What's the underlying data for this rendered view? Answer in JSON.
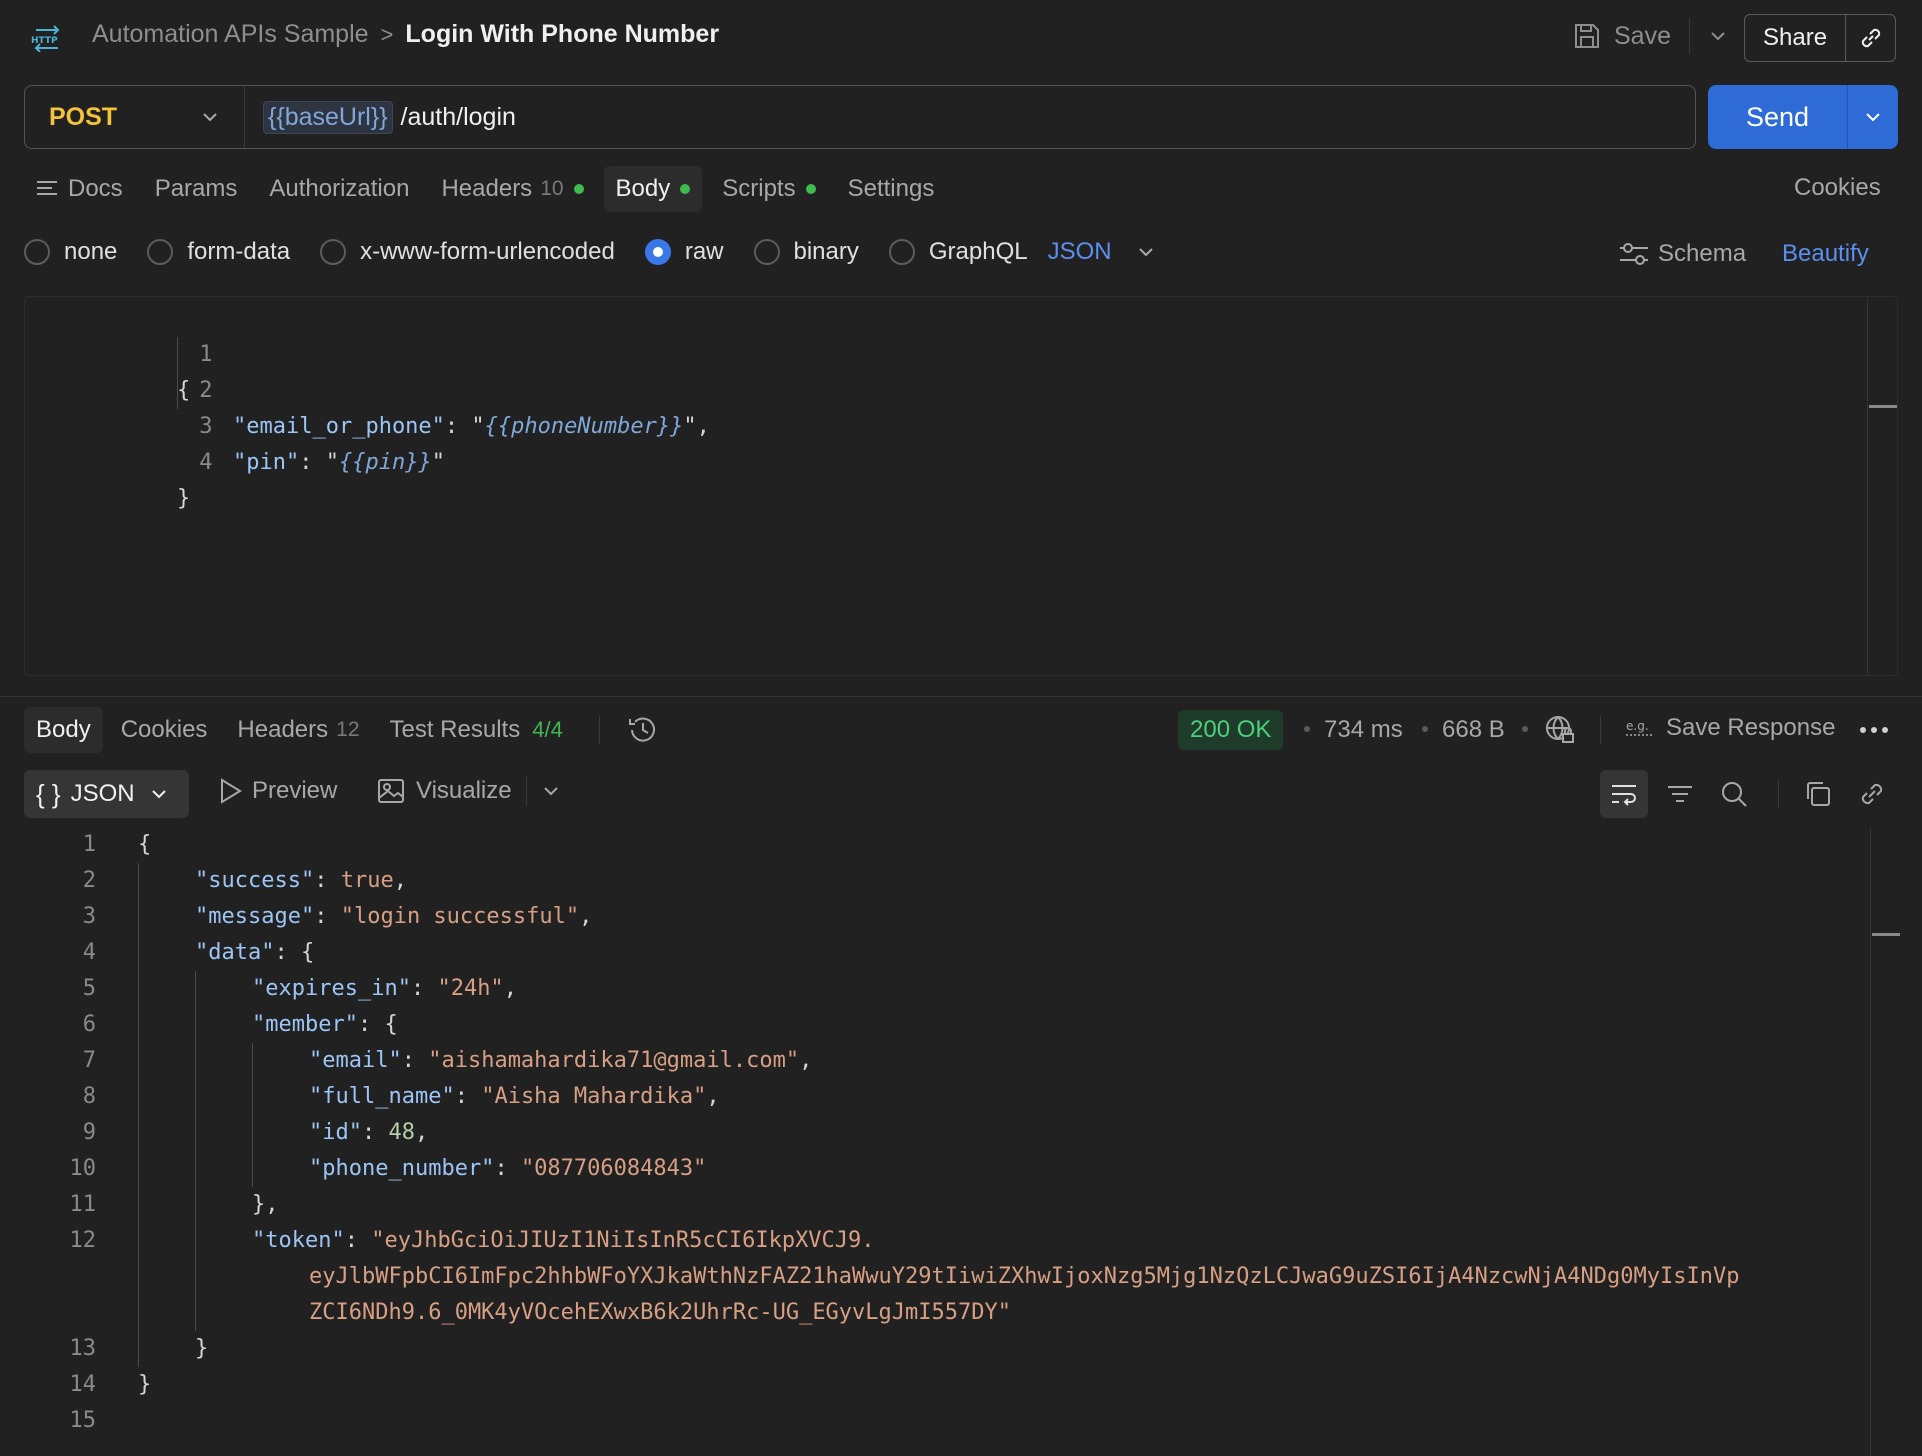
{
  "header": {
    "collection": "Automation APIs Sample",
    "separator": ">",
    "request_name": "Login With Phone Number",
    "save_label": "Save",
    "share_label": "Share"
  },
  "request": {
    "method": "POST",
    "url_var": "{{baseUrl}}",
    "url_path": "/auth/login",
    "send_label": "Send"
  },
  "request_tabs": [
    {
      "label": "Docs"
    },
    {
      "label": "Params"
    },
    {
      "label": "Authorization"
    },
    {
      "label": "Headers",
      "count": "10",
      "dot": true
    },
    {
      "label": "Body",
      "dot": true,
      "active": true
    },
    {
      "label": "Scripts",
      "dot": true
    },
    {
      "label": "Settings"
    }
  ],
  "cookies_label": "Cookies",
  "body_types": [
    {
      "label": "none",
      "checked": false
    },
    {
      "label": "form-data",
      "checked": false
    },
    {
      "label": "x-www-form-urlencoded",
      "checked": false
    },
    {
      "label": "raw",
      "checked": true
    },
    {
      "label": "binary",
      "checked": false
    },
    {
      "label": "GraphQL",
      "checked": false
    }
  ],
  "body_format": "JSON",
  "schema_label": "Schema",
  "beautify_label": "Beautify",
  "request_body_lines": [
    {
      "n": "1",
      "text": "{"
    },
    {
      "n": "2",
      "key": "\"email_or_phone\"",
      "var": "{{phoneNumber}}",
      "tail": ","
    },
    {
      "n": "3",
      "key": "\"pin\"",
      "var": "{{pin}}",
      "tail": ""
    },
    {
      "n": "4",
      "text": "}"
    }
  ],
  "response": {
    "tabs": [
      {
        "label": "Body",
        "active": true
      },
      {
        "label": "Cookies"
      },
      {
        "label": "Headers",
        "count": "12"
      },
      {
        "label": "Test Results",
        "count": "4/4"
      }
    ],
    "status": "200 OK",
    "time": "734 ms",
    "size": "668 B",
    "save_response_label": "Save Response",
    "format": "JSON",
    "preview_label": "Preview",
    "visualize_label": "Visualize"
  },
  "response_body_lines": [
    {
      "n": "1",
      "indent": 0,
      "parts": [
        [
          "p",
          "{"
        ]
      ]
    },
    {
      "n": "2",
      "indent": 1,
      "parts": [
        [
          "k",
          "\"success\""
        ],
        [
          "p",
          ": "
        ],
        [
          "b",
          "true"
        ],
        [
          "p",
          ","
        ]
      ]
    },
    {
      "n": "3",
      "indent": 1,
      "parts": [
        [
          "k",
          "\"message\""
        ],
        [
          "p",
          ": "
        ],
        [
          "s",
          "\"login successful\""
        ],
        [
          "p",
          ","
        ]
      ]
    },
    {
      "n": "4",
      "indent": 1,
      "parts": [
        [
          "k",
          "\"data\""
        ],
        [
          "p",
          ": {"
        ]
      ]
    },
    {
      "n": "5",
      "indent": 2,
      "parts": [
        [
          "k",
          "\"expires_in\""
        ],
        [
          "p",
          ": "
        ],
        [
          "s",
          "\"24h\""
        ],
        [
          "p",
          ","
        ]
      ]
    },
    {
      "n": "6",
      "indent": 2,
      "parts": [
        [
          "k",
          "\"member\""
        ],
        [
          "p",
          ": {"
        ]
      ]
    },
    {
      "n": "7",
      "indent": 3,
      "parts": [
        [
          "k",
          "\"email\""
        ],
        [
          "p",
          ": "
        ],
        [
          "s",
          "\"aishamahardika71@gmail.com\""
        ],
        [
          "p",
          ","
        ]
      ]
    },
    {
      "n": "8",
      "indent": 3,
      "parts": [
        [
          "k",
          "\"full_name\""
        ],
        [
          "p",
          ": "
        ],
        [
          "s",
          "\"Aisha Mahardika\""
        ],
        [
          "p",
          ","
        ]
      ]
    },
    {
      "n": "9",
      "indent": 3,
      "parts": [
        [
          "k",
          "\"id\""
        ],
        [
          "p",
          ": "
        ],
        [
          "n",
          "48"
        ],
        [
          "p",
          ","
        ]
      ]
    },
    {
      "n": "10",
      "indent": 3,
      "parts": [
        [
          "k",
          "\"phone_number\""
        ],
        [
          "p",
          ": "
        ],
        [
          "s",
          "\"087706084843\""
        ]
      ]
    },
    {
      "n": "11",
      "indent": 2,
      "parts": [
        [
          "p",
          "},"
        ]
      ]
    },
    {
      "n": "12",
      "indent": 2,
      "parts": [
        [
          "k",
          "\"token\""
        ],
        [
          "p",
          ": "
        ],
        [
          "s",
          "\"eyJhbGciOiJIUzI1NiIsInR5cCI6IkpXVCJ9."
        ]
      ]
    },
    {
      "n": "",
      "indent": 3,
      "parts": [
        [
          "s",
          "eyJlbWFpbCI6ImFpc2hhbWFoYXJkaWthNzFAZ21haWwuY29tIiwiZXhwIjoxNzg5Mjg1NzQzLCJwaG9uZSI6IjA4NzcwNjA4NDg0MyIsInVp"
        ]
      ]
    },
    {
      "n": "",
      "indent": 3,
      "parts": [
        [
          "s",
          "ZCI6NDh9.6_0MK4yVOcehEXwxB6k2UhrRc-UG_EGyvLgJmI557DY\""
        ]
      ]
    },
    {
      "n": "13",
      "indent": 1,
      "parts": [
        [
          "p",
          "}"
        ]
      ]
    },
    {
      "n": "14",
      "indent": 0,
      "parts": [
        [
          "p",
          "}"
        ]
      ]
    },
    {
      "n": "15",
      "indent": 0,
      "parts": []
    }
  ]
}
